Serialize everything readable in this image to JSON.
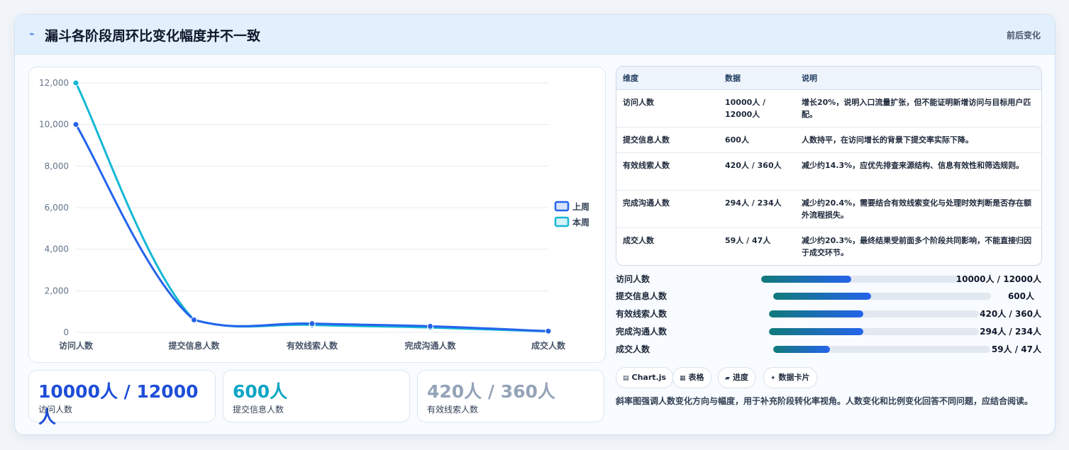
{
  "header": {
    "icon": "pulse-icon",
    "title": "漏斗各阶段周环比变化幅度并不一致",
    "right_label": "前后变化"
  },
  "chart_data": {
    "type": "line",
    "categories": [
      "访问人数",
      "提交信息人数",
      "有效线索人数",
      "完成沟通人数",
      "成交人数"
    ],
    "series": [
      {
        "name": "上周",
        "values": [
          10000,
          600,
          420,
          294,
          59
        ],
        "color": "#2563eb"
      },
      {
        "name": "本周",
        "values": [
          12000,
          600,
          360,
          234,
          47
        ],
        "color": "#14b8d4"
      }
    ],
    "ylim": [
      0,
      12000
    ],
    "yticks": [
      "0",
      "2,000",
      "4,000",
      "6,000",
      "8,000",
      "10,000",
      "12,000"
    ],
    "grid": true,
    "legend": "right"
  },
  "stats": [
    {
      "value": "10000人 / 12000人",
      "label": "访问人数",
      "color": "#1d4ed8"
    },
    {
      "value": "600人",
      "label": "提交信息人数",
      "color": "#0ea5c6"
    },
    {
      "value": "420人 / 360人",
      "label": "有效线索人数",
      "color": "#94a3b8"
    }
  ],
  "table": {
    "headers": [
      "维度",
      "数据",
      "说明"
    ],
    "rows": [
      [
        "访问人数",
        "10000人 / 12000人",
        "增长20%，说明入口流量扩张，但不能证明新增访问与目标用户匹配。"
      ],
      [
        "提交信息人数",
        "600人",
        "人数持平，在访问增长的背景下提交率实际下降。"
      ],
      [
        "有效线索人数",
        "420人 / 360人",
        "减少约14.3%，应优先排查来源结构、信息有效性和筛选规则。"
      ],
      [
        "完成沟通人数",
        "294人 / 234人",
        "减少约20.4%，需要结合有效线索变化与处理时效判断是否存在额外流程损失。"
      ],
      [
        "成交人数",
        "59人 / 47人",
        "减少约20.3%，最终结果受前面多个阶段共同影响，不能直接归因于成交环节。"
      ]
    ]
  },
  "progress": [
    {
      "label": "访问人数",
      "value": "10000人 / 12000人",
      "fraction": 0.45
    },
    {
      "label": "提交信息人数",
      "value": "600人",
      "fraction": 0.45
    },
    {
      "label": "有效线索人数",
      "value": "420人 / 360人",
      "fraction": 0.45
    },
    {
      "label": "完成沟通人数",
      "value": "294人 / 234人",
      "fraction": 0.45
    },
    {
      "label": "成交人数",
      "value": "59人 / 47人",
      "fraction": 0.26
    }
  ],
  "tags": [
    {
      "icon": "chart-icon",
      "label": "Chart.js"
    },
    {
      "icon": "table-icon",
      "label": "表格"
    },
    {
      "icon": "progress-icon",
      "label": "进度"
    },
    {
      "icon": "sparkle-icon",
      "label": "数据卡片"
    }
  ],
  "note": "斜率图强调人数变化方向与幅度，用于补充阶段转化率视角。人数变化和比例变化回答不同问题，应结合阅读。"
}
